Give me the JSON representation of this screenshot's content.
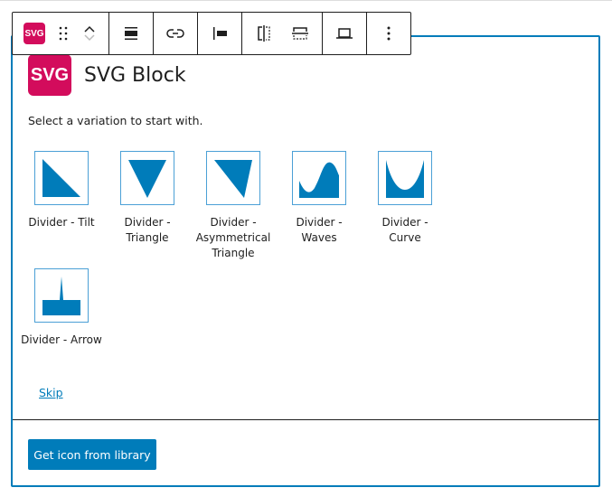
{
  "toolbar": {
    "block_icon_label": "SVG"
  },
  "header": {
    "icon_label": "SVG",
    "title": "SVG Block"
  },
  "instructions": "Select a variation to start with.",
  "variations": [
    {
      "label": "Divider - Tilt"
    },
    {
      "label": "Divider - Triangle"
    },
    {
      "label": "Divider - Asymmetrical Triangle"
    },
    {
      "label": "Divider - Waves"
    },
    {
      "label": "Divider - Curve"
    },
    {
      "label": "Divider - Arrow"
    }
  ],
  "skip_label": "Skip",
  "library_button": "Get icon from library",
  "colors": {
    "accent": "#007cba",
    "brand": "#d30c5c"
  }
}
